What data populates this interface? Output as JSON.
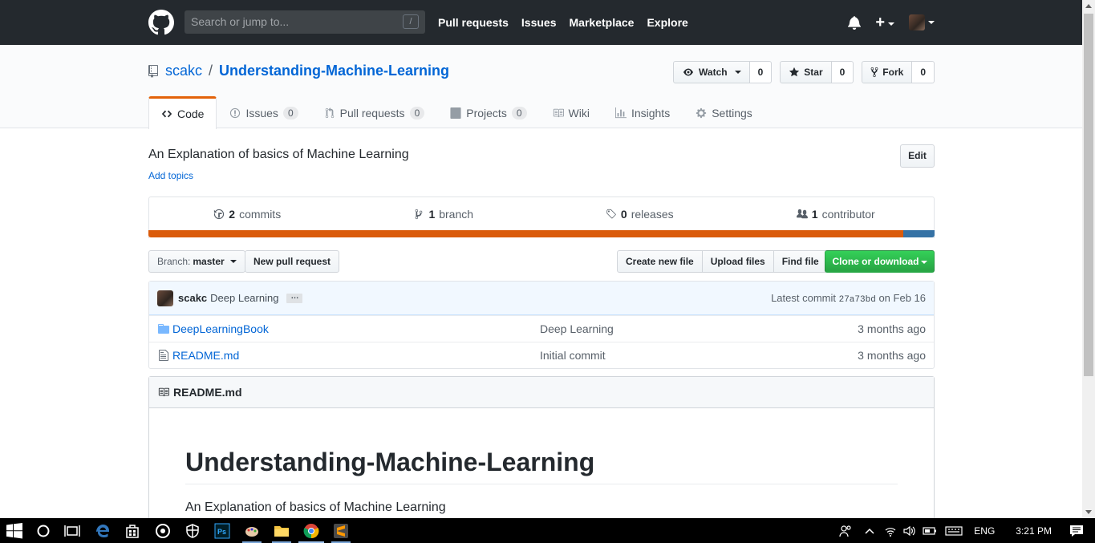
{
  "header": {
    "search_placeholder": "Search or jump to...",
    "search_shortcut": "/",
    "nav": [
      "Pull requests",
      "Issues",
      "Marketplace",
      "Explore"
    ]
  },
  "repo": {
    "owner": "scakc",
    "separator": "/",
    "name": "Understanding-Machine-Learning",
    "watch_label": "Watch",
    "watch_count": "0",
    "star_label": "Star",
    "star_count": "0",
    "fork_label": "Fork",
    "fork_count": "0"
  },
  "tabs": [
    {
      "label": "Code",
      "count": ""
    },
    {
      "label": "Issues",
      "count": "0"
    },
    {
      "label": "Pull requests",
      "count": "0"
    },
    {
      "label": "Projects",
      "count": "0"
    },
    {
      "label": "Wiki",
      "count": ""
    },
    {
      "label": "Insights",
      "count": ""
    },
    {
      "label": "Settings",
      "count": ""
    }
  ],
  "description": "An Explanation of basics of Machine Learning",
  "add_topics": "Add topics",
  "edit_label": "Edit",
  "summary": {
    "commits_count": "2",
    "commits_label": "commits",
    "branch_count": "1",
    "branch_label": "branch",
    "releases_count": "0",
    "releases_label": "releases",
    "contributor_count": "1",
    "contributor_label": "contributor"
  },
  "language_bar": [
    {
      "color": "#DA5B0B",
      "percent": 96
    },
    {
      "color": "#3572A5",
      "percent": 4
    }
  ],
  "file_nav": {
    "branch_label": "Branch:",
    "branch_value": "master",
    "new_pr": "New pull request",
    "create_file": "Create new file",
    "upload_files": "Upload files",
    "find_file": "Find file",
    "clone": "Clone or download"
  },
  "latest_commit": {
    "author": "scakc",
    "message": "Deep Learning",
    "ellipsis": "…",
    "prefix": "Latest commit",
    "sha": "27a73bd",
    "date": "on Feb 16"
  },
  "files": [
    {
      "type": "folder",
      "name": "DeepLearningBook",
      "message": "Deep Learning",
      "age": "3 months ago"
    },
    {
      "type": "file",
      "name": "README.md",
      "message": "Initial commit",
      "age": "3 months ago"
    }
  ],
  "readme": {
    "header": "README.md",
    "title": "Understanding-Machine-Learning",
    "body": "An Explanation of basics of Machine Learning"
  },
  "taskbar": {
    "language": "ENG",
    "time": "3:21 PM"
  },
  "colors": {
    "header_bg": "#24292e",
    "link": "#0366d6",
    "active_tab": "#e36209",
    "clone_green": "#28a745"
  }
}
